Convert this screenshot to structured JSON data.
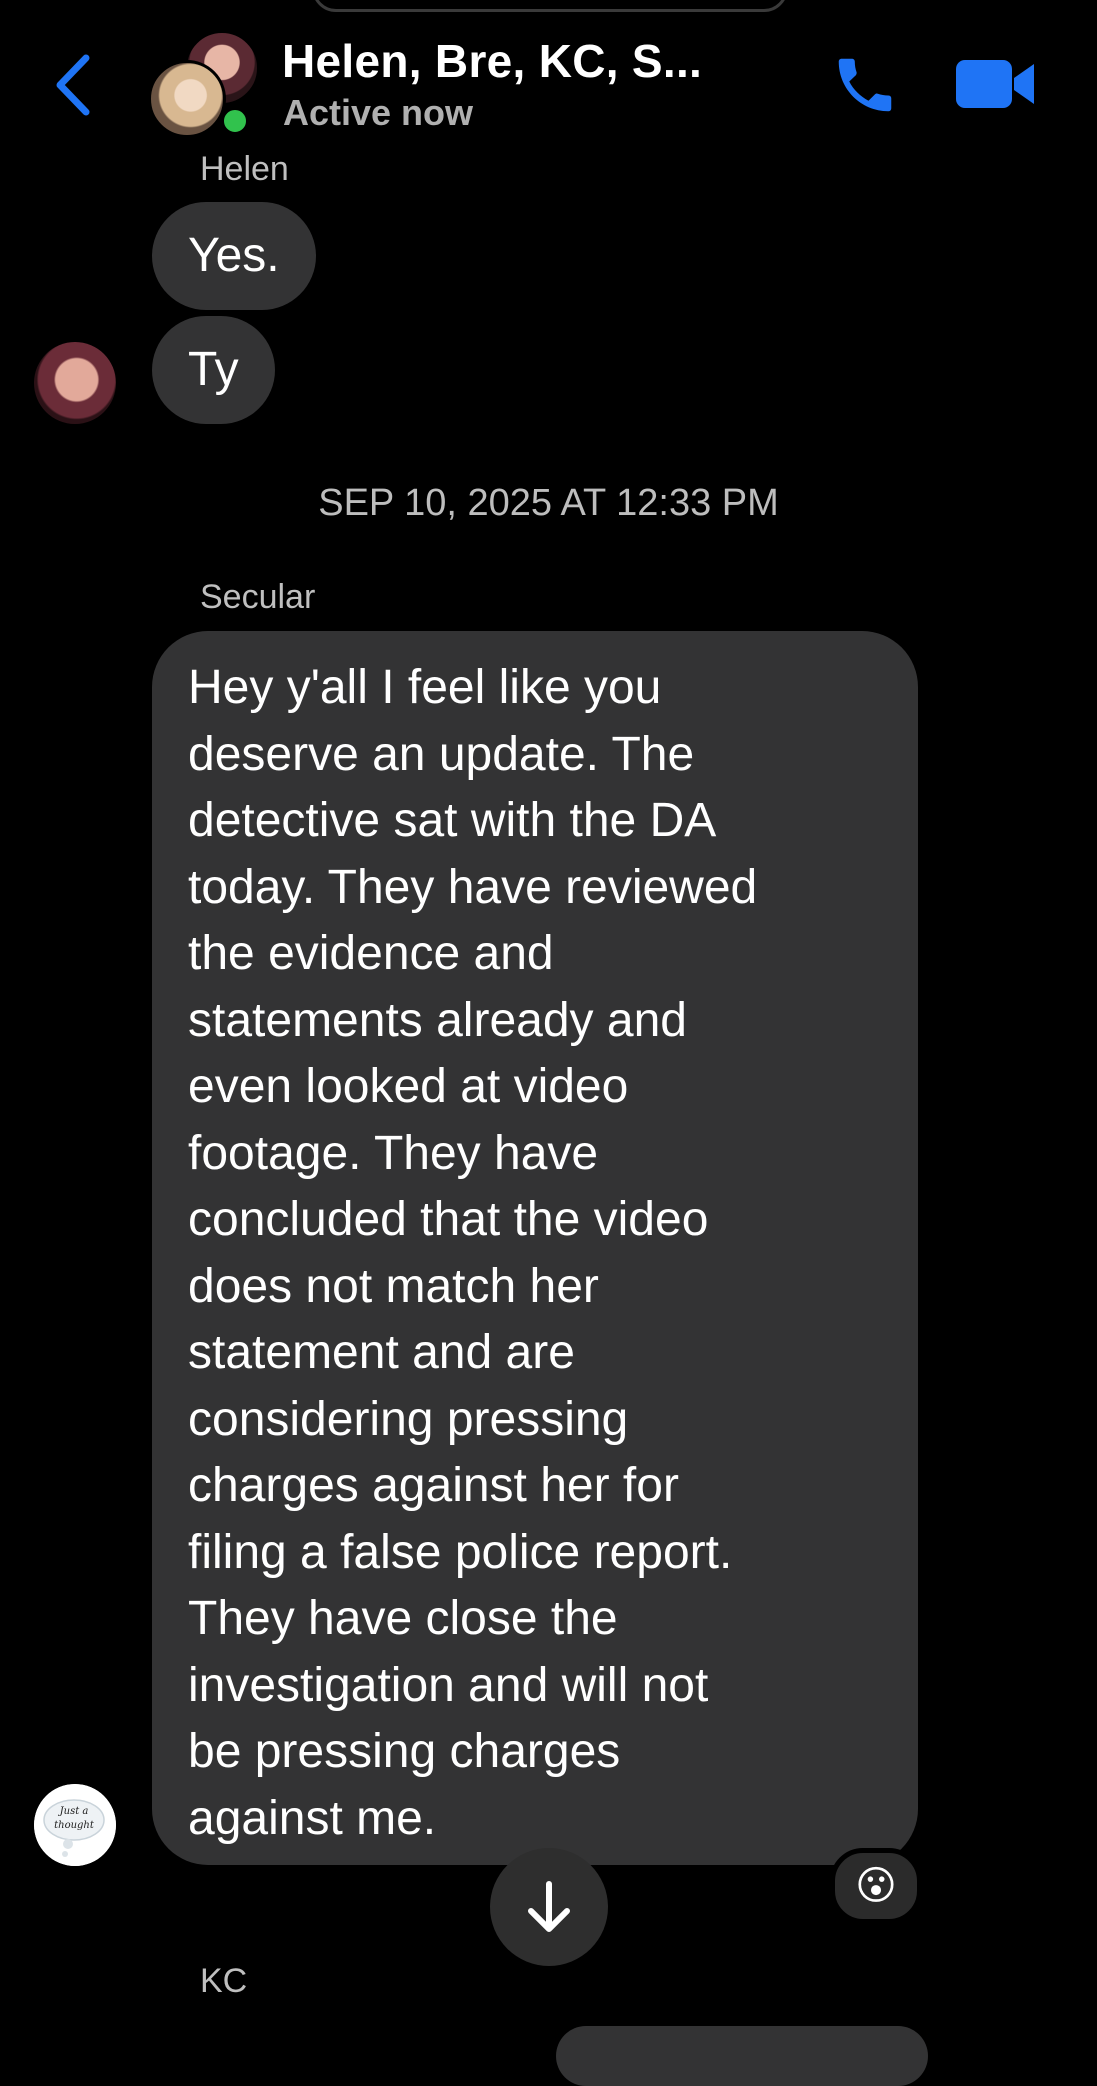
{
  "header": {
    "title": "Helen, Bre, KC, S...",
    "status": "Active now"
  },
  "messages": [
    {
      "sender": "Helen",
      "bubbles": [
        "Yes.",
        "Ty"
      ]
    }
  ],
  "timestamp": "SEP 10, 2025 AT 12:33 PM",
  "long_message": {
    "sender": "Secular",
    "lines": [
      "Hey y'all I feel like you",
      "deserve an update. The",
      "detective sat with the DA",
      "today. They have reviewed",
      "the evidence and",
      "statements already and",
      "even looked at video",
      "footage. They have",
      "concluded that the video",
      "does not match her",
      "statement and are",
      "considering pressing",
      "charges against her for",
      "filing a false police report.",
      "They have close the",
      "investigation and will not",
      "be pressing charges",
      "against me."
    ],
    "reaction": "😮",
    "avatar_text": [
      "Just a",
      "thought"
    ]
  },
  "next_sender": "KC",
  "icons": {
    "back": "chevron-left-icon",
    "call": "phone-icon",
    "video": "video-camera-icon",
    "scroll": "arrow-down-icon"
  },
  "colors": {
    "accent": "#1f74f5",
    "bubble": "#333334",
    "online": "#31c24d"
  }
}
